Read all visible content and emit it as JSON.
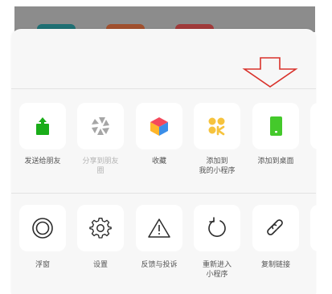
{
  "share_row": {
    "items": [
      {
        "label": "发送给朋友",
        "icon": "share-up-icon",
        "color": "#1aad19",
        "enabled": true
      },
      {
        "label": "分享到朋友\n圈",
        "icon": "moments-icon",
        "color": "#9a9a9a",
        "enabled": false
      },
      {
        "label": "收藏",
        "icon": "favorites-cube-icon",
        "color": "#ff9d2e",
        "enabled": true
      },
      {
        "label": "添加到\n我的小程序",
        "icon": "my-miniprogram-icon",
        "color": "#f6c33d",
        "enabled": true
      },
      {
        "label": "添加到桌面",
        "icon": "add-to-desktop-icon",
        "color": "#44c92b",
        "enabled": true
      }
    ]
  },
  "action_row": {
    "items": [
      {
        "label": "浮窗",
        "icon": "float-window-icon"
      },
      {
        "label": "设置",
        "icon": "gear-icon"
      },
      {
        "label": "反馈与投诉",
        "icon": "warning-triangle-icon"
      },
      {
        "label": "重新进入\n小程序",
        "icon": "reload-icon"
      },
      {
        "label": "复制链接",
        "icon": "link-icon"
      }
    ]
  },
  "annotation": {
    "arrow_color": "#d9322b"
  }
}
